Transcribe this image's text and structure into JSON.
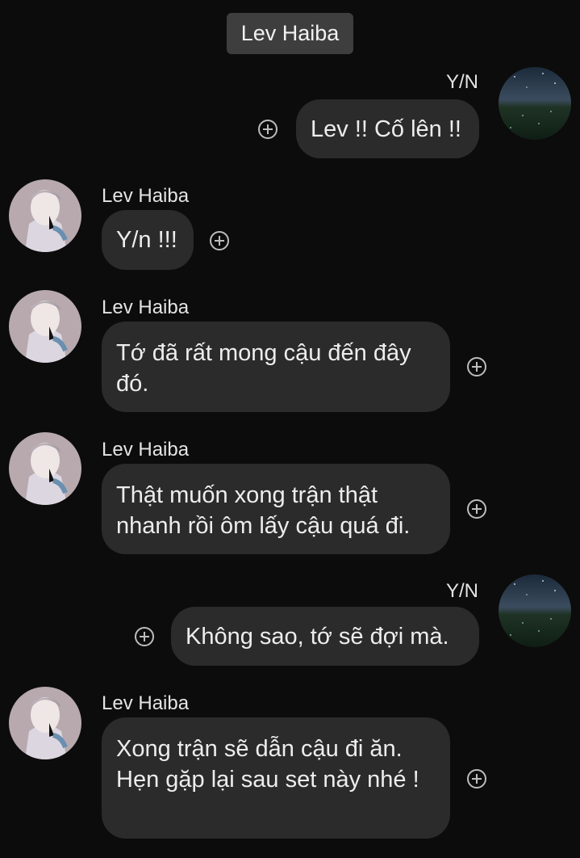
{
  "chat": {
    "title": "Lev Haiba",
    "messages": [
      {
        "sender": "Y/N",
        "side": "right",
        "text": "Lev !! Cố lên !!"
      },
      {
        "sender": "Lev Haiba",
        "side": "left",
        "text": "Y/n !!!"
      },
      {
        "sender": "Lev Haiba",
        "side": "left",
        "text": "Tớ đã rất mong cậu đến đây đó."
      },
      {
        "sender": "Lev Haiba",
        "side": "left",
        "text": "Thật muốn xong trận thật nhanh rồi ôm lấy cậu quá đi."
      },
      {
        "sender": "Y/N",
        "side": "right",
        "text": "Không sao, tớ sẽ đợi mà."
      },
      {
        "sender": "Lev Haiba",
        "side": "left",
        "text": "Xong trận sẽ dẫn cậu đi ăn. Hẹn gặp lại sau set này nhé !"
      }
    ]
  },
  "icons": {
    "react": "plus-circle-icon",
    "avatar_lev": "lev-avatar-image",
    "avatar_yn": "night-field-avatar-image"
  },
  "colors": {
    "background": "#0c0c0c",
    "bubble": "#2b2b2b",
    "header_chip": "#3e3e3e",
    "text": "#ececec"
  }
}
